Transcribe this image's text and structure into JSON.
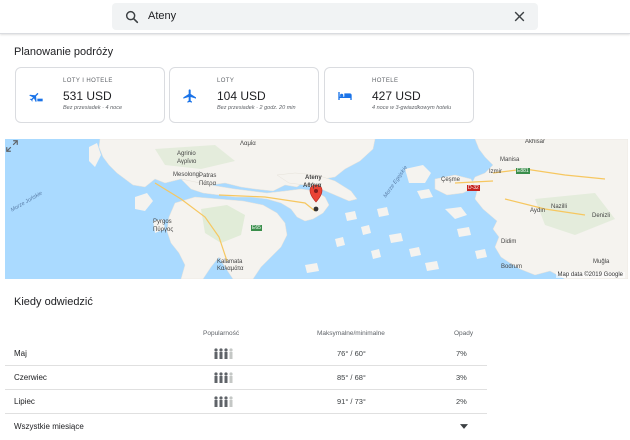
{
  "search": {
    "value": "Ateny"
  },
  "planning": {
    "title": "Planowanie podróży",
    "cards": [
      {
        "icon": "flight-hotel-icon",
        "label": "LOTY I HOTELE",
        "price": "531 USD",
        "desc": "Bez przesiadek · 4 noce"
      },
      {
        "icon": "flight-icon",
        "label": "LOTY",
        "price": "104 USD",
        "desc": "Bez przesiadek · 2 godz. 20 min"
      },
      {
        "icon": "hotel-icon",
        "label": "HOTELE",
        "price": "427 USD",
        "desc": "4 noce w 3-gwiazdkowym hotelu"
      }
    ]
  },
  "map": {
    "attribution": "Map data ©2019 Google",
    "places": {
      "lamia": "Λαμία",
      "agrinio": "Agrinio",
      "agrinio_gr": "Αγρίνιο",
      "mesolongi": "Mesolongi",
      "patras": "Patras",
      "patras_gr": "Πάτρα",
      "pyrgos": "Pyrgos",
      "pyrgos_gr": "Πύργος",
      "kalamata": "Kalamata",
      "kalamata_gr": "Καλαμάτα",
      "athens": "Ateny",
      "athens_gr": "Αθήνα",
      "akhisar": "Akhisar",
      "manisa": "Manisa",
      "izmir": "Izmir",
      "cesme": "Çeşme",
      "aydin": "Aydın",
      "nazilli": "Nazilli",
      "denizli": "Denizli",
      "mugla": "Muğla",
      "didim": "Didim",
      "bodrum": "Bodrum"
    },
    "seas": {
      "ionian": "Morze Jońskie",
      "aegean": "Morze Egejskie"
    },
    "roads": {
      "e65": "E65",
      "e881": "E881",
      "d32": "D-32"
    }
  },
  "weather": {
    "title": "Kiedy odwiedzić",
    "headers": {
      "popularity": "Popularność",
      "temp": "Maksymalne/minimalne",
      "rain": "Opady"
    },
    "rows": [
      {
        "month": "Maj",
        "temp": "76° / 60°",
        "rain": "7%",
        "popularity": 0.85
      },
      {
        "month": "Czerwiec",
        "temp": "85° / 68°",
        "rain": "3%",
        "popularity": 0.9
      },
      {
        "month": "Lipiec",
        "temp": "91° / 73°",
        "rain": "2%",
        "popularity": 0.9
      }
    ],
    "all_months": "Wszystkie miesiące"
  },
  "colors": {
    "accent": "#1a73e8",
    "pin": "#ea4335",
    "land": "#f5f3ef",
    "water": "#aadaff"
  }
}
